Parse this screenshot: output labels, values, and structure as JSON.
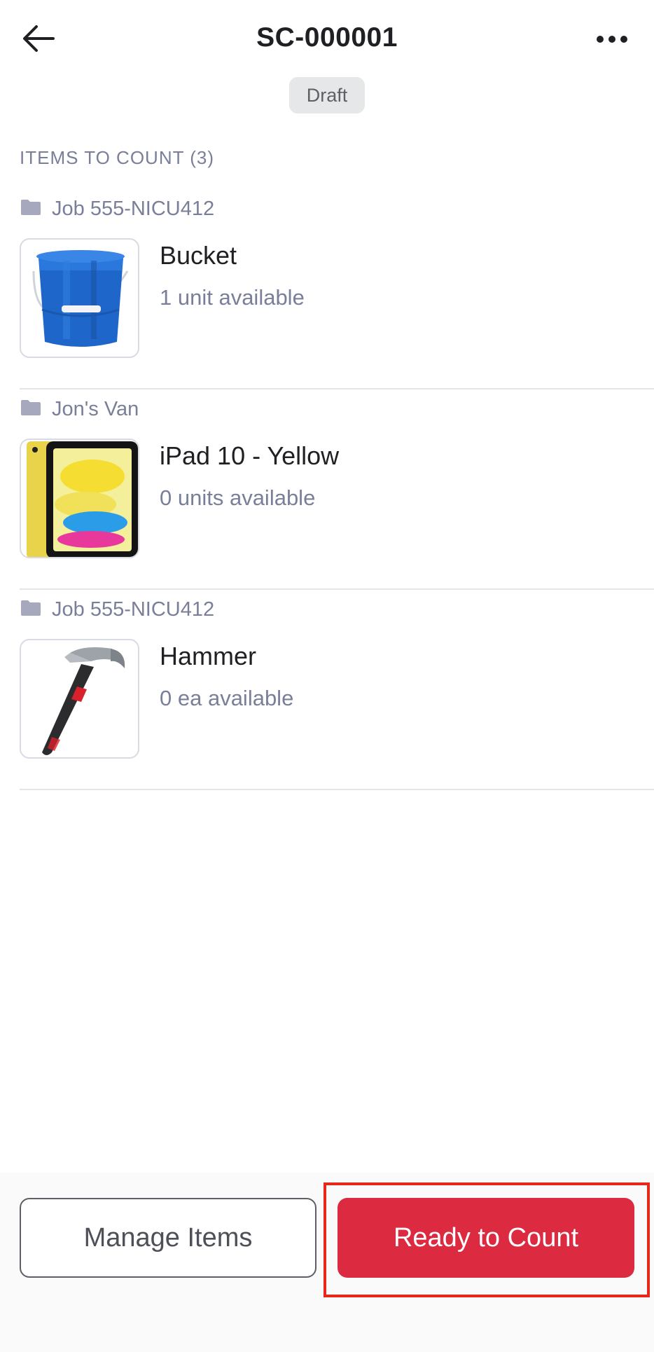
{
  "header": {
    "title": "SC-000001",
    "back_icon": "arrow-left-icon",
    "more_icon": "more-horizontal-icon",
    "status": "Draft"
  },
  "section": {
    "heading": "ITEMS TO COUNT (3)"
  },
  "items": [
    {
      "location": "Job 555-NICU412",
      "name": "Bucket",
      "availability": "1 unit available",
      "image": "blue-bucket"
    },
    {
      "location": "Jon's Van",
      "name": "iPad 10 - Yellow",
      "availability": "0 units available",
      "image": "yellow-ipad"
    },
    {
      "location": "Job 555-NICU412",
      "name": "Hammer",
      "availability": "0 ea available",
      "image": "hammer"
    }
  ],
  "footer": {
    "manage_label": "Manage Items",
    "ready_label": "Ready to Count"
  },
  "colors": {
    "accent": "#dc2a40",
    "highlight": "#e8271b",
    "muted_text": "#7a7f99"
  }
}
